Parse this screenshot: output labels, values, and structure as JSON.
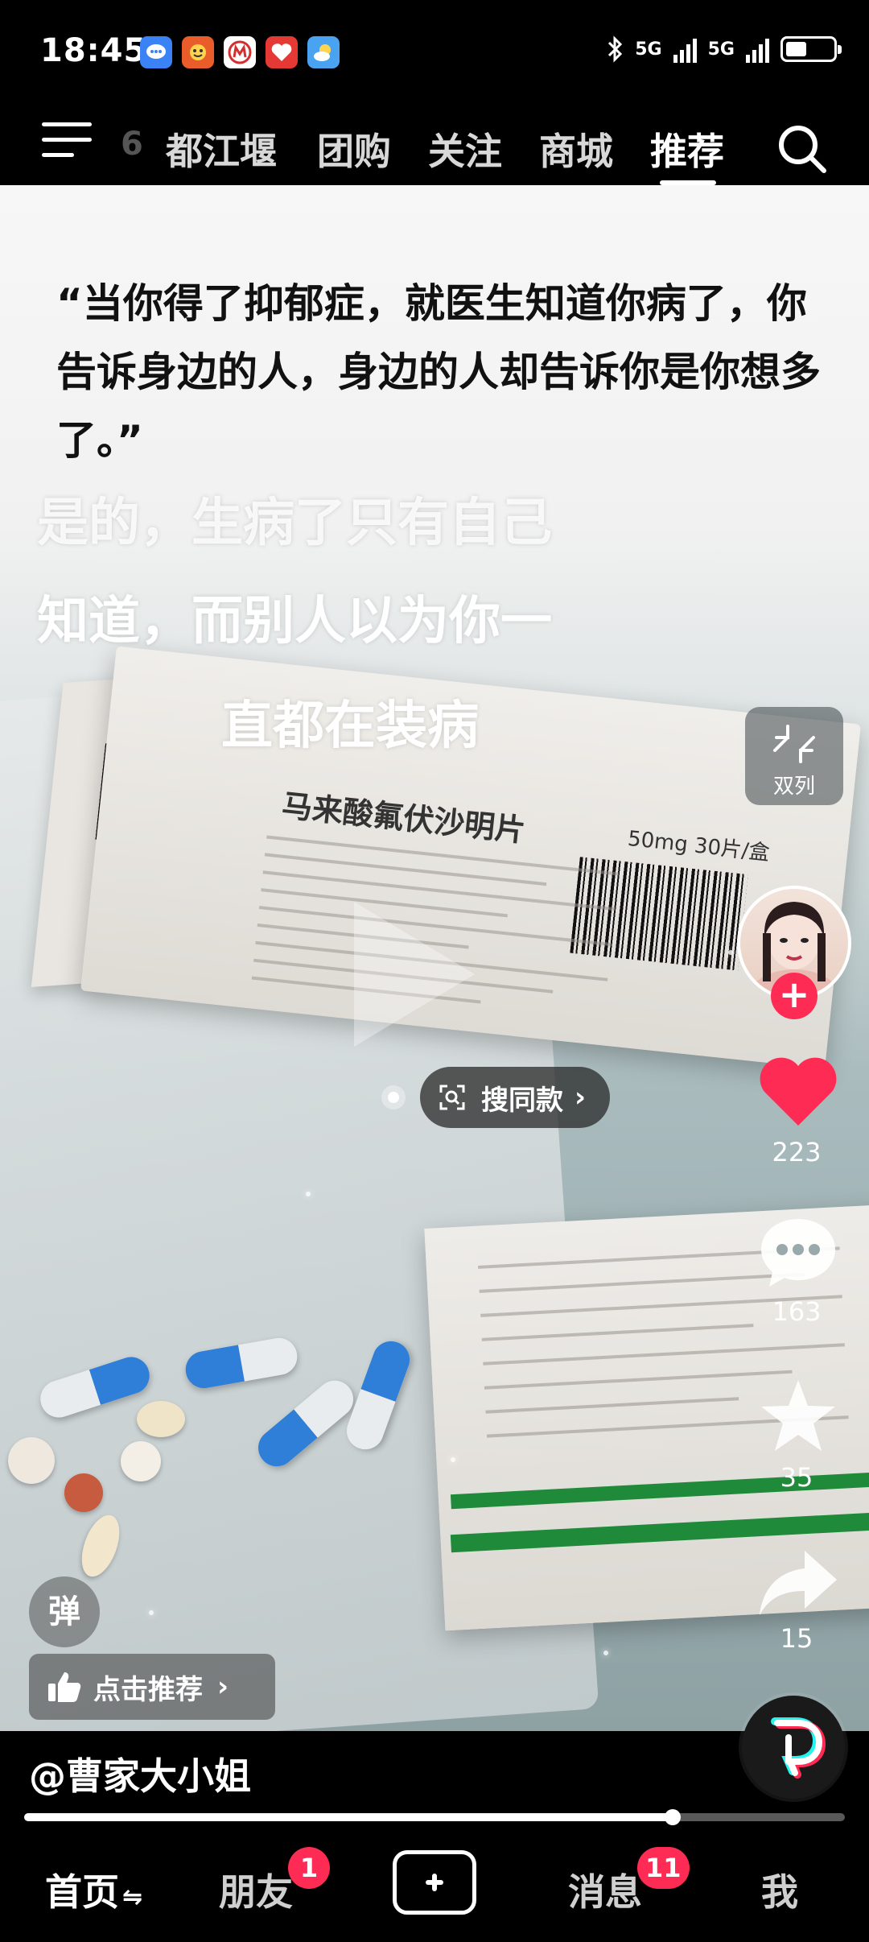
{
  "status_bar": {
    "time": "18:45",
    "app_icons": [
      "chat-bubble-icon",
      "delivery-app-icon",
      "bank-app-icon",
      "charity-app-icon",
      "weather-app-icon"
    ],
    "network_left": "5G",
    "network_right": "5G",
    "bluetooth_icon": "bluetooth-icon",
    "battery_level": 0.45
  },
  "top_nav": {
    "faded_label": "6",
    "tabs": [
      {
        "label": "都江堰",
        "active": false
      },
      {
        "label": "团购",
        "active": false
      },
      {
        "label": "关注",
        "active": false
      },
      {
        "label": "商城",
        "active": false
      },
      {
        "label": "推荐",
        "active": true
      }
    ]
  },
  "video": {
    "quote": "“当你得了抑郁症，就医生知道你病了，你告诉身边的人，身边的人却告诉你是你想多了。”",
    "subtitle_lines": [
      "是的，生病了只有自己",
      "知道，而别人以为你一",
      "直都在装病"
    ],
    "medicine_name": "马来酸氟伏沙明片",
    "medicine_dose": "50mg 30片/盒",
    "search_same_label": "搜同款",
    "danmu_label": "弹",
    "recommend_label": "点击推荐"
  },
  "right_rail": {
    "dual_column_label": "双列",
    "likes": "223",
    "comments": "163",
    "favorites": "35",
    "shares": "15",
    "colors": {
      "like": "#fe2c55",
      "follow": "#fe2c55"
    }
  },
  "author": "@曹家大小姐",
  "progress": 0.79,
  "bottom_nav": {
    "items": [
      {
        "label": "首页",
        "active": true
      },
      {
        "label": "朋友",
        "badge": "1"
      },
      {
        "label": "消息",
        "badge": "11"
      },
      {
        "label": "我"
      }
    ]
  }
}
